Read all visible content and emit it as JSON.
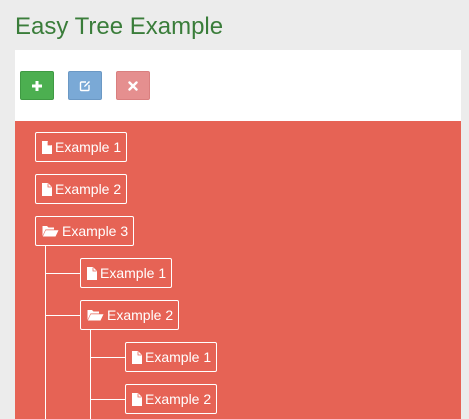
{
  "page": {
    "title": "Easy Tree Example"
  },
  "toolbar": {
    "add_icon": "plus-icon",
    "edit_icon": "edit-icon",
    "delete_icon": "close-icon",
    "colors": {
      "add": "#4caf50",
      "edit": "#7aa9d6",
      "delete": "#e58f8f"
    }
  },
  "tree": {
    "background": "#e66355",
    "nodes": [
      {
        "label": "Example 1",
        "icon": "file-icon"
      },
      {
        "label": "Example 2",
        "icon": "file-icon"
      },
      {
        "label": "Example 3",
        "icon": "folder-open-icon",
        "children": [
          {
            "label": "Example 1",
            "icon": "file-icon"
          },
          {
            "label": "Example 2",
            "icon": "folder-open-icon",
            "children": [
              {
                "label": "Example 1",
                "icon": "file-icon"
              },
              {
                "label": "Example 2",
                "icon": "file-icon"
              }
            ]
          }
        ]
      }
    ]
  }
}
